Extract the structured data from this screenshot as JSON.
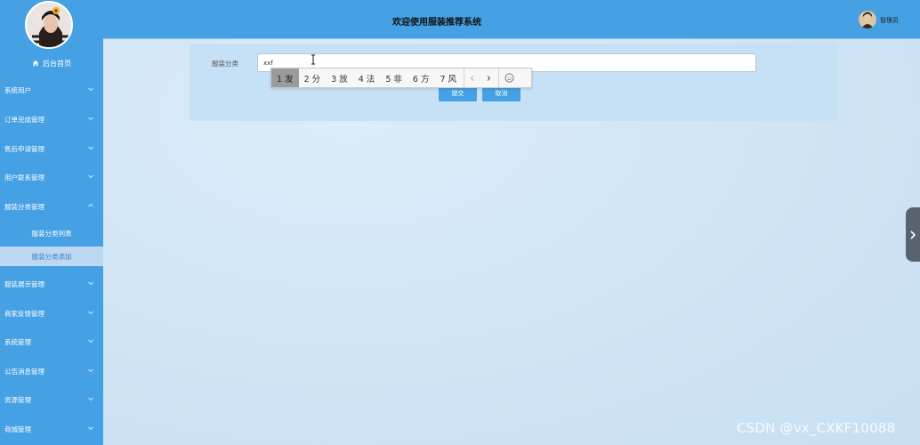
{
  "header": {
    "title": "欢迎使用服装推荐系统",
    "user_name": "管理员"
  },
  "sidebar": {
    "home_label": "后台首页",
    "items": [
      {
        "label": "系统用户"
      },
      {
        "label": "订单完成管理"
      },
      {
        "label": "售后申请管理"
      },
      {
        "label": "用户联系管理"
      },
      {
        "label": "服装分类管理"
      },
      {
        "label": "服装展示管理"
      },
      {
        "label": "商家反馈管理"
      },
      {
        "label": "系统管理"
      },
      {
        "label": "公告消息管理"
      },
      {
        "label": "资源管理"
      },
      {
        "label": "商城管理"
      }
    ],
    "submenu": [
      {
        "label": "服装分类列表"
      },
      {
        "label": "服装分类添加"
      }
    ],
    "active_submenu": "服装分类添加"
  },
  "form": {
    "label": "服装分类",
    "input_value": "xxf",
    "submit_label": "提交",
    "cancel_label": "取消"
  },
  "ime": {
    "candidates": [
      "1 发",
      "2 分",
      "3 放",
      "4 法",
      "5 非",
      "6 方",
      "7 风"
    ],
    "selected_index": 0
  },
  "watermark": "CSDN @vx_CXKF10088",
  "colors": {
    "primary": "#45a0e4",
    "panel": "#c6e1f6",
    "active_submenu_bg": "#bcd8f2"
  }
}
